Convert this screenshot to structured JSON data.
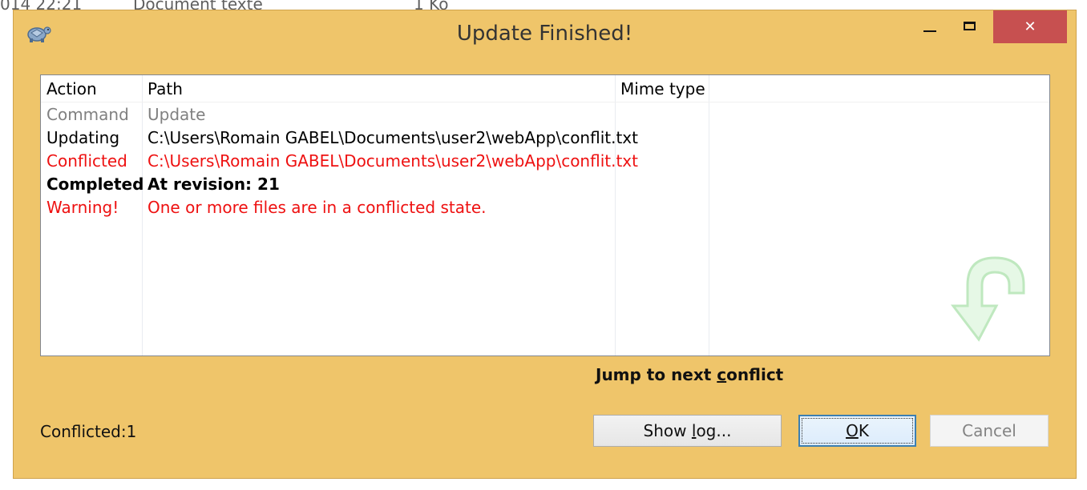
{
  "background_window": {
    "date": "014 22:21",
    "type": "Document texte",
    "size": "1 Ko"
  },
  "window": {
    "title": "Update Finished!",
    "close_glyph": "✕",
    "icons": {
      "app": "tortoise-icon",
      "minimize": "minimize-icon",
      "maximize": "maximize-icon",
      "close": "close-icon"
    },
    "colors": {
      "frame": "#efc56a",
      "close_bg": "#c75050"
    }
  },
  "list": {
    "columns": [
      "Action",
      "Path",
      "Mime type"
    ],
    "rows": [
      {
        "action": "Command",
        "path": "Update",
        "style": "gray"
      },
      {
        "action": "Updating",
        "path": "C:\\Users\\Romain GABEL\\Documents\\user2\\webApp\\conflit.txt",
        "style": "black"
      },
      {
        "action": "Conflicted",
        "path": "C:\\Users\\Romain GABEL\\Documents\\user2\\webApp\\conflit.txt",
        "style": "red"
      },
      {
        "action": "Completed",
        "path": "At revision: 21",
        "style": "bold"
      },
      {
        "action": "Warning!",
        "path": "One or more files are in a conflicted state.",
        "style": "red"
      }
    ],
    "watermark_icon": "update-arrow-icon"
  },
  "jump_link": {
    "before": "Jump to next ",
    "accel": "c",
    "after": "onflict"
  },
  "status": "Conflicted:1",
  "buttons": {
    "show_log": {
      "before": "Show ",
      "accel": "l",
      "after": "og..."
    },
    "ok": {
      "accel": "O",
      "after": "K"
    },
    "cancel": "Cancel"
  }
}
